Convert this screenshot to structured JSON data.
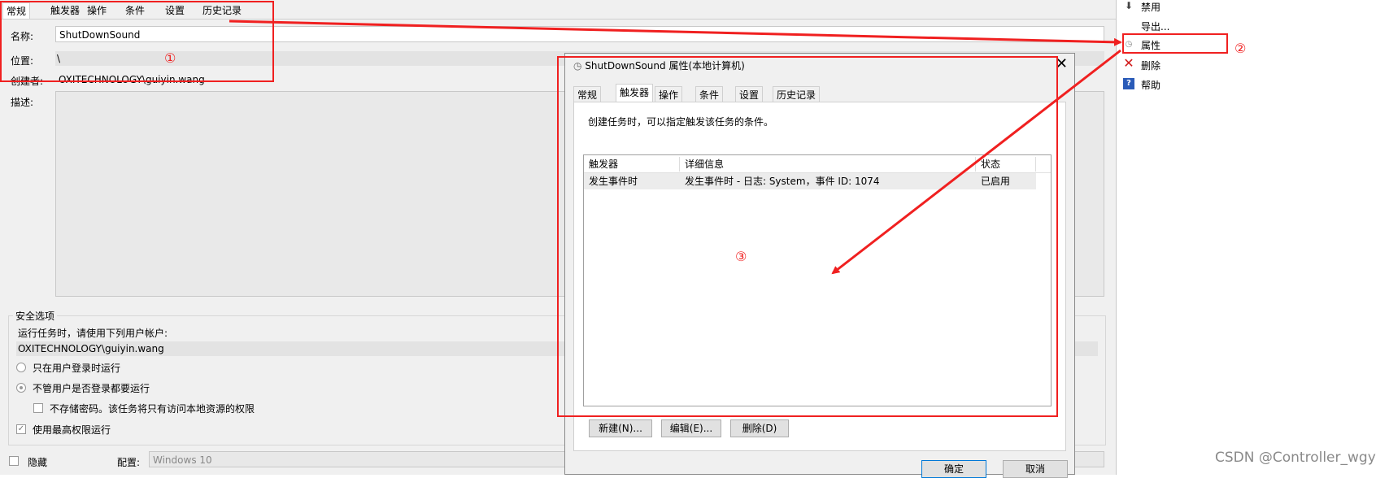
{
  "left_panel": {
    "tabs": [
      "常规",
      "触发器",
      "操作",
      "条件",
      "设置",
      "历史记录"
    ],
    "name_label": "名称:",
    "name_value": "ShutDownSound",
    "location_label": "位置:",
    "location_value": "\\",
    "author_label": "创建者:",
    "author_value": "OXITECHNOLOGY\\guiyin.wang",
    "description_label": "描述:",
    "security_title": "安全选项",
    "run_as_label": "运行任务时，请使用下列用户帐户:",
    "run_as_user": "OXITECHNOLOGY\\guiyin.wang",
    "radio_logged_on": "只在用户登录时运行",
    "radio_whether": "不管用户是否登录都要运行",
    "check_no_password": "不存储密码。该任务将只有访问本地资源的权限",
    "check_highest": "使用最高权限运行",
    "hidden_label": "隐藏",
    "config_label": "配置:",
    "config_value": "Windows 10"
  },
  "actions_pane": {
    "items": [
      {
        "label": "禁用",
        "icon": "arrow-down-icon"
      },
      {
        "label": "导出...",
        "icon": ""
      },
      {
        "label": "属性",
        "icon": "clock-icon"
      },
      {
        "label": "删除",
        "icon": "delete-x-icon"
      },
      {
        "label": "帮助",
        "icon": "help-icon"
      }
    ]
  },
  "dialog": {
    "title": "ShutDownSound 属性(本地计算机)",
    "tabs": [
      "常规",
      "触发器",
      "操作",
      "条件",
      "设置",
      "历史记录"
    ],
    "description": "创建任务时，可以指定触发该任务的条件。",
    "columns": [
      "触发器",
      "详细信息",
      "状态"
    ],
    "rows": [
      {
        "trigger": "发生事件时",
        "details": "发生事件时 - 日志: System，事件 ID: 1074",
        "status": "已启用"
      }
    ],
    "btn_new": "新建(N)...",
    "btn_edit": "编辑(E)...",
    "btn_delete": "删除(D)",
    "btn_ok": "确定",
    "btn_cancel": "取消"
  },
  "annotations": {
    "marker1": "①",
    "marker2": "②",
    "marker3": "③",
    "color": "#f02020"
  },
  "watermark": "CSDN @Controller_wgy"
}
